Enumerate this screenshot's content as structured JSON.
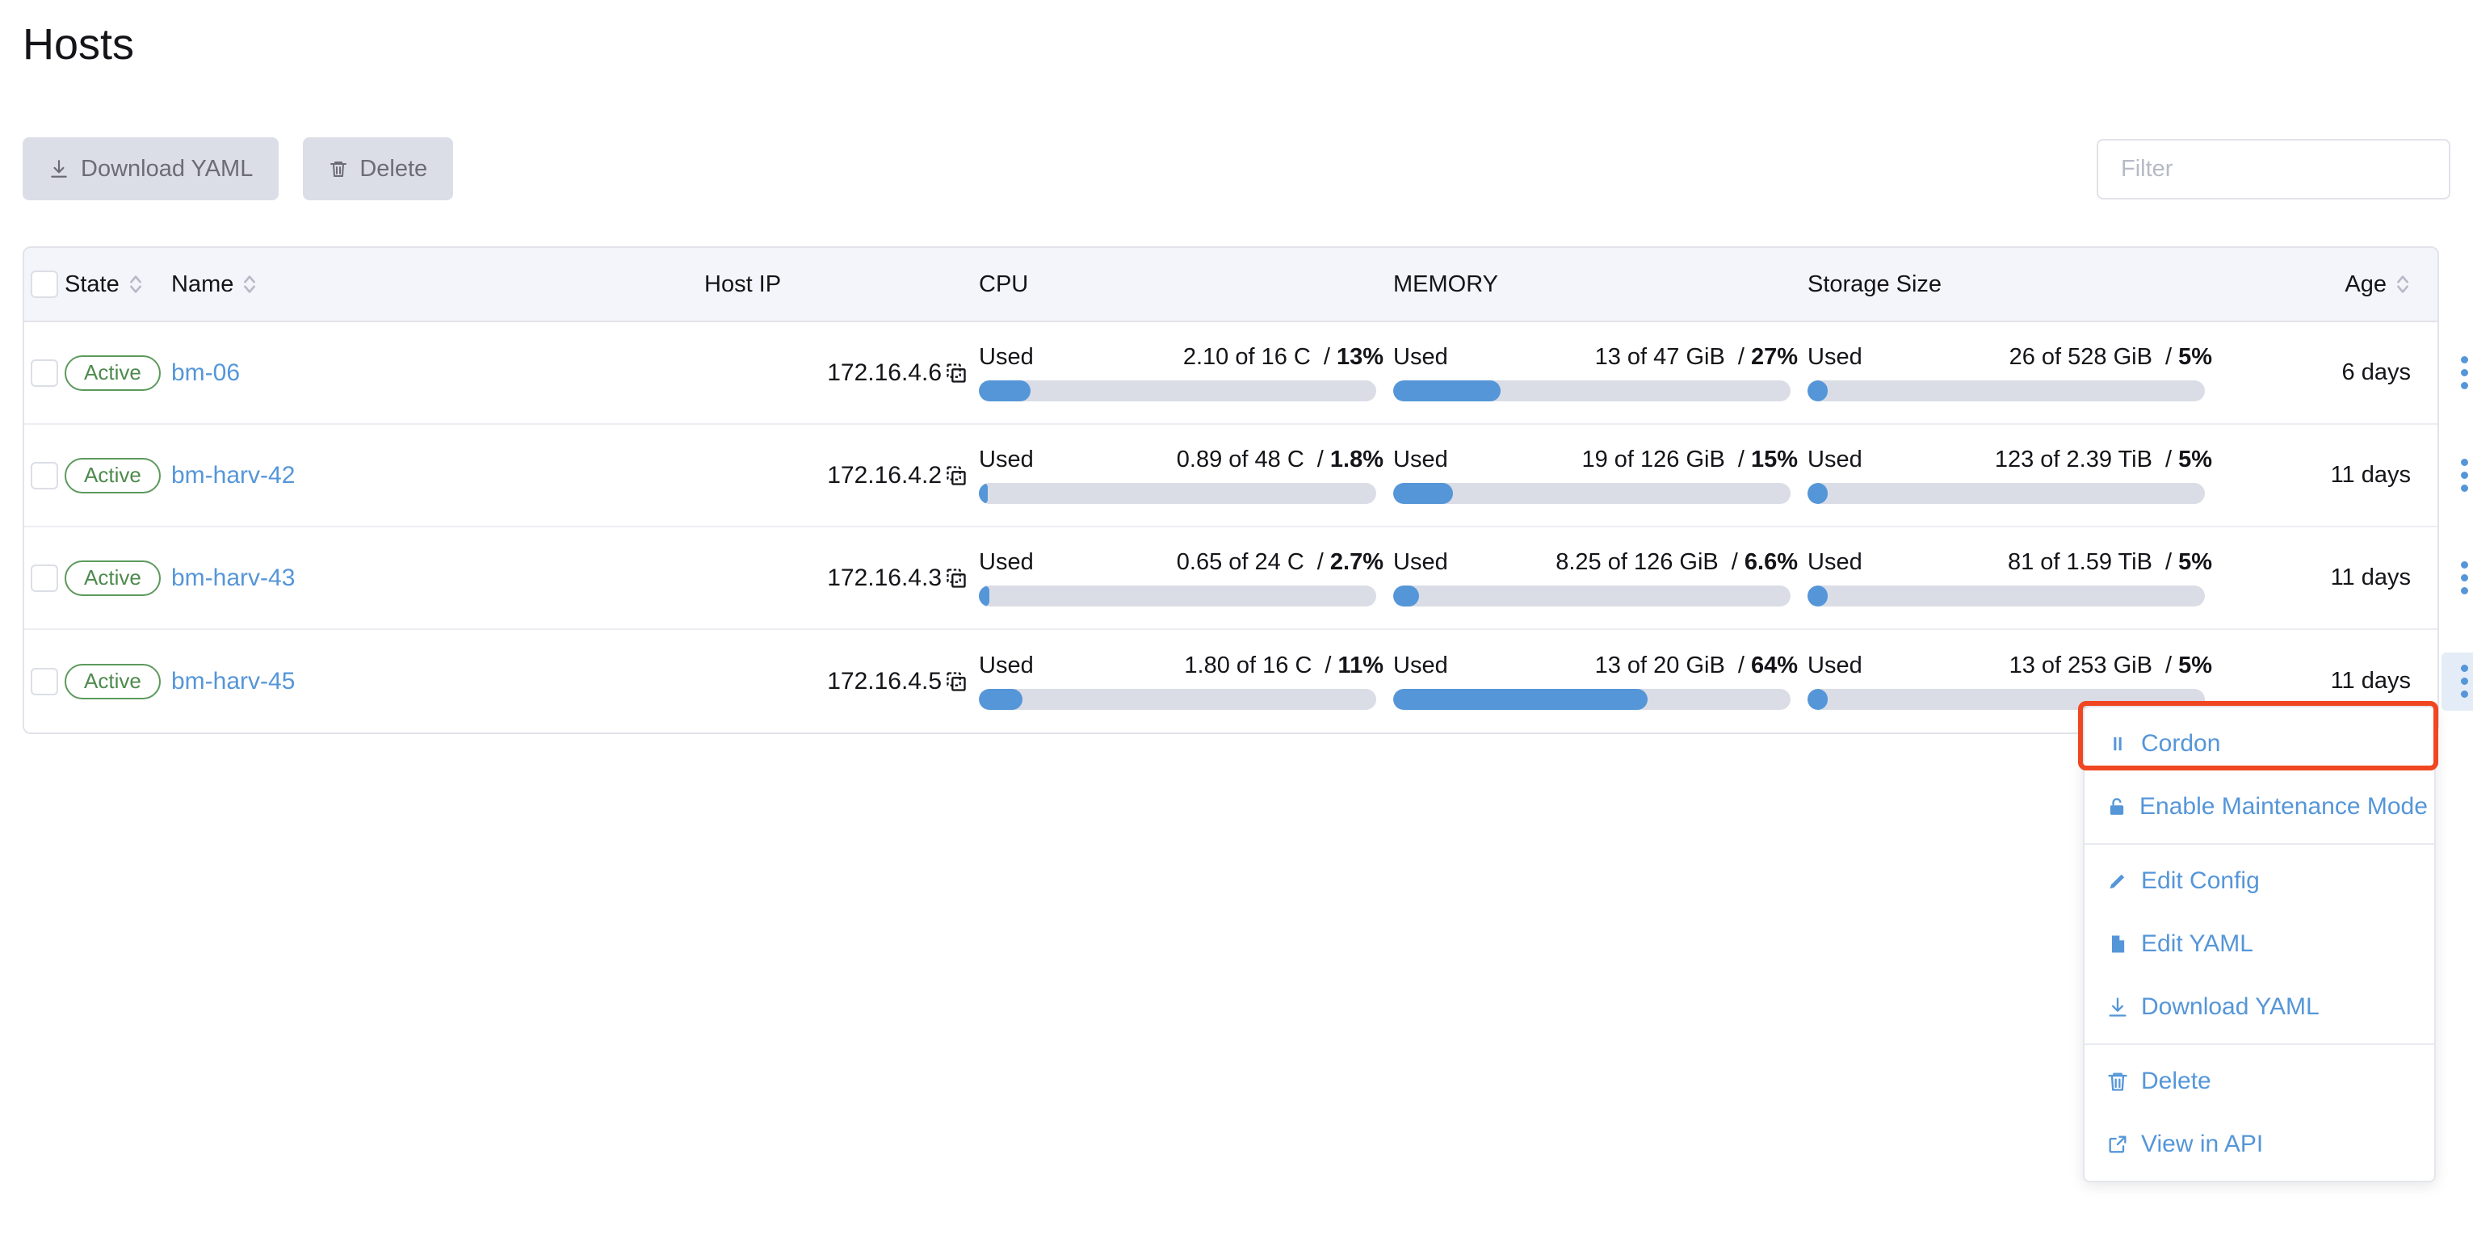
{
  "header": {
    "title": "Hosts"
  },
  "toolbar": {
    "download_yaml_label": "Download YAML",
    "download_yaml_icon": "download-icon",
    "delete_label": "Delete",
    "delete_icon": "trash-icon"
  },
  "search": {
    "placeholder": "Filter",
    "value": ""
  },
  "table": {
    "columns": [
      {
        "key": "state",
        "label": "State",
        "sortable": true
      },
      {
        "key": "name",
        "label": "Name",
        "sortable": true
      },
      {
        "key": "host_ip",
        "label": "Host IP",
        "sortable": false
      },
      {
        "key": "cpu",
        "label": "CPU",
        "sortable": false
      },
      {
        "key": "memory",
        "label": "MEMORY",
        "sortable": false
      },
      {
        "key": "storage",
        "label": "Storage Size",
        "sortable": false
      },
      {
        "key": "age",
        "label": "Age",
        "sortable": true
      }
    ],
    "used_label": "Used",
    "rows": [
      {
        "state": "Active",
        "name": "bm-06",
        "host_ip": "172.16.4.6",
        "cpu": {
          "used": "2.10 of 16 C",
          "pct": "13%",
          "pct_num": 13
        },
        "memory": {
          "used": "13 of 47 GiB",
          "pct": "27%",
          "pct_num": 27
        },
        "storage": {
          "used": "26 of 528 GiB",
          "pct": "5%",
          "pct_num": 5
        },
        "age": "6 days"
      },
      {
        "state": "Active",
        "name": "bm-harv-42",
        "host_ip": "172.16.4.2",
        "cpu": {
          "used": "0.89 of 48 C",
          "pct": "1.8%",
          "pct_num": 1.8
        },
        "memory": {
          "used": "19 of 126 GiB",
          "pct": "15%",
          "pct_num": 15
        },
        "storage": {
          "used": "123 of 2.39 TiB",
          "pct": "5%",
          "pct_num": 5
        },
        "age": "11 days"
      },
      {
        "state": "Active",
        "name": "bm-harv-43",
        "host_ip": "172.16.4.3",
        "cpu": {
          "used": "0.65 of 24 C",
          "pct": "2.7%",
          "pct_num": 2.7
        },
        "memory": {
          "used": "8.25 of 126 GiB",
          "pct": "6.6%",
          "pct_num": 6.6
        },
        "storage": {
          "used": "81 of 1.59 TiB",
          "pct": "5%",
          "pct_num": 5
        },
        "age": "11 days"
      },
      {
        "state": "Active",
        "name": "bm-harv-45",
        "host_ip": "172.16.4.5",
        "cpu": {
          "used": "1.80 of 16 C",
          "pct": "11%",
          "pct_num": 11
        },
        "memory": {
          "used": "13 of 20 GiB",
          "pct": "64%",
          "pct_num": 64
        },
        "storage": {
          "used": "13 of 253 GiB",
          "pct": "5%",
          "pct_num": 5
        },
        "age": "11 days"
      }
    ]
  },
  "context_menu": {
    "items": [
      {
        "label": "Cordon",
        "icon": "pause-icon",
        "highlighted": true,
        "separator_after": false
      },
      {
        "label": "Enable Maintenance Mode",
        "icon": "lock-icon",
        "highlighted": false,
        "separator_after": true
      },
      {
        "label": "Edit Config",
        "icon": "pencil-icon",
        "highlighted": false,
        "separator_after": false
      },
      {
        "label": "Edit YAML",
        "icon": "file-icon",
        "highlighted": false,
        "separator_after": false
      },
      {
        "label": "Download YAML",
        "icon": "download-icon",
        "highlighted": false,
        "separator_after": true
      },
      {
        "label": "Delete",
        "icon": "trash-icon",
        "highlighted": false,
        "separator_after": false
      },
      {
        "label": "View in API",
        "icon": "external-link-icon",
        "highlighted": false,
        "separator_after": false
      }
    ]
  },
  "colors": {
    "accent_blue": "#5596d8",
    "active_green": "#4e8a4e",
    "highlight_red": "#f04621",
    "header_bg": "#f4f5fa",
    "track_gray": "#dadde6",
    "button_gray": "#dcdee7"
  }
}
